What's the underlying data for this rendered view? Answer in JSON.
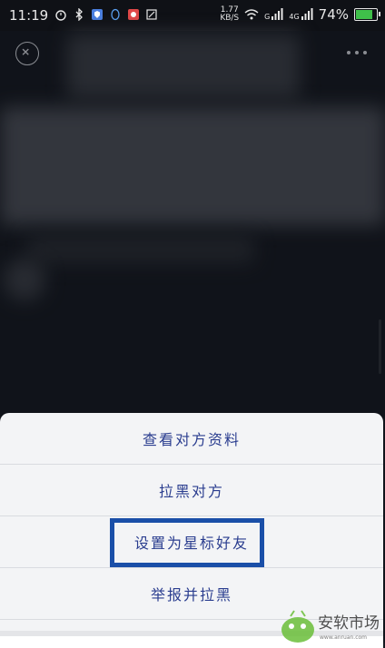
{
  "status_bar": {
    "time": "11:19",
    "net_speed_value": "1.77",
    "net_speed_unit": "KB/S",
    "signal_1_label": "G",
    "signal_2_label": "4G",
    "battery_percent": "74%",
    "battery_level": 0.74,
    "battery_color": "#3fbf4a"
  },
  "action_sheet": {
    "items": [
      "查看对方资料",
      "拉黑对方",
      "设置为星标好友",
      "举报并拉黑"
    ],
    "highlighted_item_index": 2,
    "text_color": "#2a3d8f",
    "highlight_color": "#1a4fa8"
  },
  "watermark": {
    "text": "安软市场",
    "subtext": "www.anruan.com"
  }
}
